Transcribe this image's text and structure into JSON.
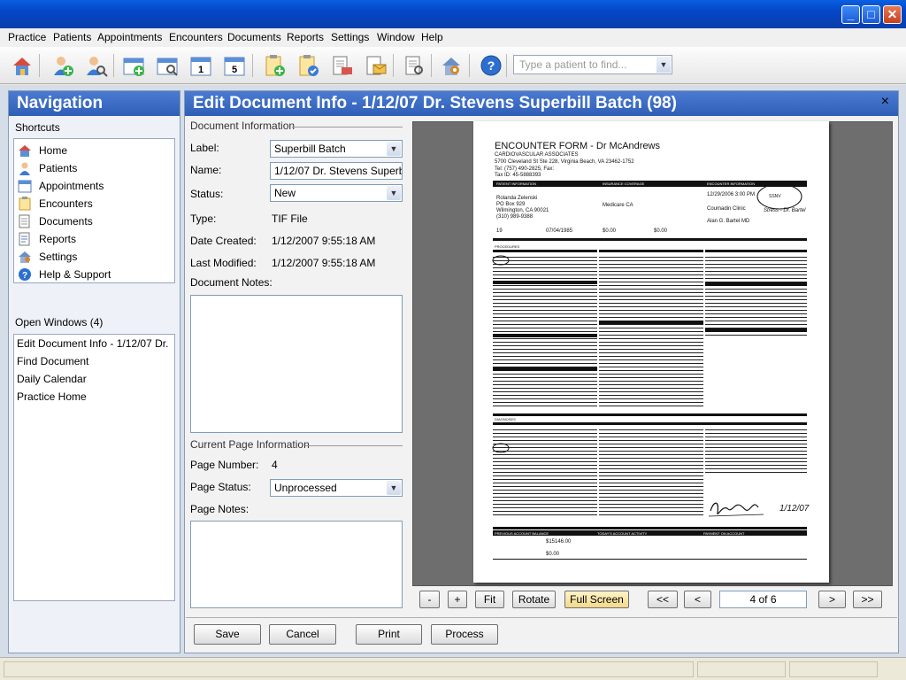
{
  "window": {
    "minimize": "_",
    "maximize": "□",
    "close": "✕"
  },
  "menu": [
    "Practice",
    "Patients",
    "Appointments",
    "Encounters",
    "Documents",
    "Reports",
    "Settings",
    "Window",
    "Help"
  ],
  "toolbar": {
    "patient_search_placeholder": "Type a patient to find...",
    "icons": [
      "home-icon",
      "add-patient-icon",
      "find-patient-icon",
      "add-appointment-icon",
      "find-appointment-icon",
      "day-calendar-icon",
      "week-calendar-icon",
      "add-encounter-icon",
      "encounter-check-icon",
      "document-scan-icon",
      "document-mail-icon",
      "document-find-icon",
      "settings-icon",
      "help-icon"
    ]
  },
  "nav": {
    "title": "Navigation",
    "shortcuts_label": "Shortcuts",
    "shortcuts": [
      {
        "label": "Home",
        "icon": "home-icon",
        "color": "#d9534f"
      },
      {
        "label": "Patients",
        "icon": "patient-icon",
        "color": "#3a7bd5"
      },
      {
        "label": "Appointments",
        "icon": "calendar-icon",
        "color": "#4a8fdf"
      },
      {
        "label": "Encounters",
        "icon": "encounter-icon",
        "color": "#e59a2b"
      },
      {
        "label": "Documents",
        "icon": "documents-icon",
        "color": "#7a8aa0"
      },
      {
        "label": "Reports",
        "icon": "reports-icon",
        "color": "#8a9ab5"
      },
      {
        "label": "Settings",
        "icon": "settings-icon",
        "color": "#d08a2e"
      },
      {
        "label": "Help & Support",
        "icon": "help-icon",
        "color": "#2d6fd0"
      }
    ],
    "open_windows_label": "Open Windows (4)",
    "open_windows": [
      "Edit Document Info - 1/12/07 Dr. ...",
      "Find Document",
      "Daily Calendar",
      "Practice Home"
    ]
  },
  "main": {
    "title": "Edit Document Info - 1/12/07 Dr. Stevens Superbill Batch (98)",
    "close": "×",
    "doc_info_header": "Document Information",
    "fields": {
      "label_label": "Label:",
      "label_value": "Superbill Batch",
      "name_label": "Name:",
      "name_value": "1/12/07 Dr. Stevens Superbill",
      "status_label": "Status:",
      "status_value": "New",
      "type_label": "Type:",
      "type_value": "TIF File",
      "created_label": "Date Created:",
      "created_value": "1/12/2007 9:55:18 AM",
      "modified_label": "Last Modified:",
      "modified_value": "1/12/2007 9:55:18 AM",
      "notes_label": "Document Notes:"
    },
    "page_info_header": "Current Page Information",
    "page": {
      "number_label": "Page Number:",
      "number_value": "4",
      "status_label": "Page Status:",
      "status_value": "Unprocessed",
      "notes_label": "Page Notes:"
    },
    "viewer": {
      "buttons": {
        "zoom_out": "-",
        "zoom_in": "+",
        "fit": "Fit",
        "rotate": "Rotate",
        "fullscreen": "Full Screen",
        "first": "<<",
        "prev": "<",
        "next": ">",
        "last": ">>"
      },
      "page_indicator": "4 of 6"
    },
    "actions": {
      "save": "Save",
      "cancel": "Cancel",
      "print": "Print",
      "process": "Process"
    }
  },
  "document": {
    "title": "ENCOUNTER FORM - Dr McAndrews",
    "org": "CARDIOVASCULAR ASSOCIATES",
    "address": "5700 Cleveland St Ste 228, Virginia Beach, VA 23462-1752",
    "tel": "Tel: (757) 490-2825, Fax:",
    "taxid": "Tax ID: 45-5888393",
    "patient_header": "PATIENT INFORMATION",
    "insurance_header": "INSURANCE COVERAGE",
    "encounter_header": "ENCOUNTER INFORMATION",
    "patient_name": "Rolanda  Zelenski",
    "patient_addr1": "PO Box 929",
    "patient_addr2": "Wilmington, CA 90021",
    "patient_phone": "(310) 989-9388",
    "insurance": "Medicare CA",
    "enc_date": "12/29/2006 3:00 PM",
    "enc_place": "Coumadin Clinic",
    "provider": "Alan G. Bartel MD",
    "handwritten_note": "Stress - Dr. Bartel",
    "circled": "SSNV",
    "age": "19",
    "dob": "07/04/1985",
    "amt1": "$0.00",
    "amt2": "$0.00",
    "total": "$15146.00",
    "today": "$0.00",
    "signature_date": "1/12/07",
    "section_procedures": "PROCEDURES",
    "section_diagnoses": "DIAGNOSES",
    "prev_balance": "PREVIOUS ACCOUNT BALANCE",
    "today_activity": "TODAY'S ACCOUNT ACTIVITY",
    "payment": "PAYMENT ON ACCOUNT"
  }
}
